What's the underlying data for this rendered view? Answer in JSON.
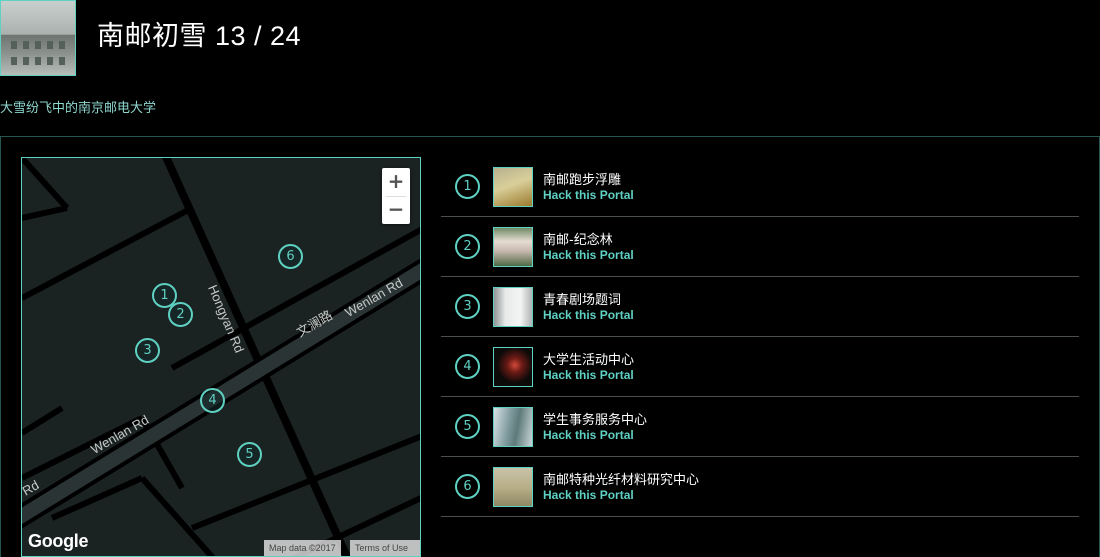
{
  "header": {
    "title": "南邮初雪 13 / 24",
    "subtitle": "大雪纷飞中的南京邮电大学"
  },
  "map": {
    "zoom_in": "+",
    "zoom_out": "−",
    "google_logo": "Google",
    "map_data": "Map data ©2017",
    "terms": "Terms of Use",
    "road_labels": {
      "hongyan": "Hongyan Rd",
      "wenlan_cn": "文澜路",
      "wenlan_upper": "Wenlan Rd",
      "wenlan_lower": "Wenlan Rd",
      "rd_edge": "n Rd"
    },
    "markers": [
      "1",
      "2",
      "3",
      "4",
      "5",
      "6"
    ]
  },
  "portals": [
    {
      "number": "1",
      "name": "南邮跑步浮雕",
      "action": "Hack this Portal"
    },
    {
      "number": "2",
      "name": "南邮-纪念林",
      "action": "Hack this Portal"
    },
    {
      "number": "3",
      "name": "青春剧场题词",
      "action": "Hack this Portal"
    },
    {
      "number": "4",
      "name": "大学生活动中心",
      "action": "Hack this Portal"
    },
    {
      "number": "5",
      "name": "学生事务服务中心",
      "action": "Hack this Portal"
    },
    {
      "number": "6",
      "name": "南邮特种光纤材料研究中心",
      "action": "Hack this Portal"
    }
  ],
  "colors": {
    "accent": "#5fd1c3",
    "background": "#000000",
    "map_bg": "#1b2222"
  }
}
